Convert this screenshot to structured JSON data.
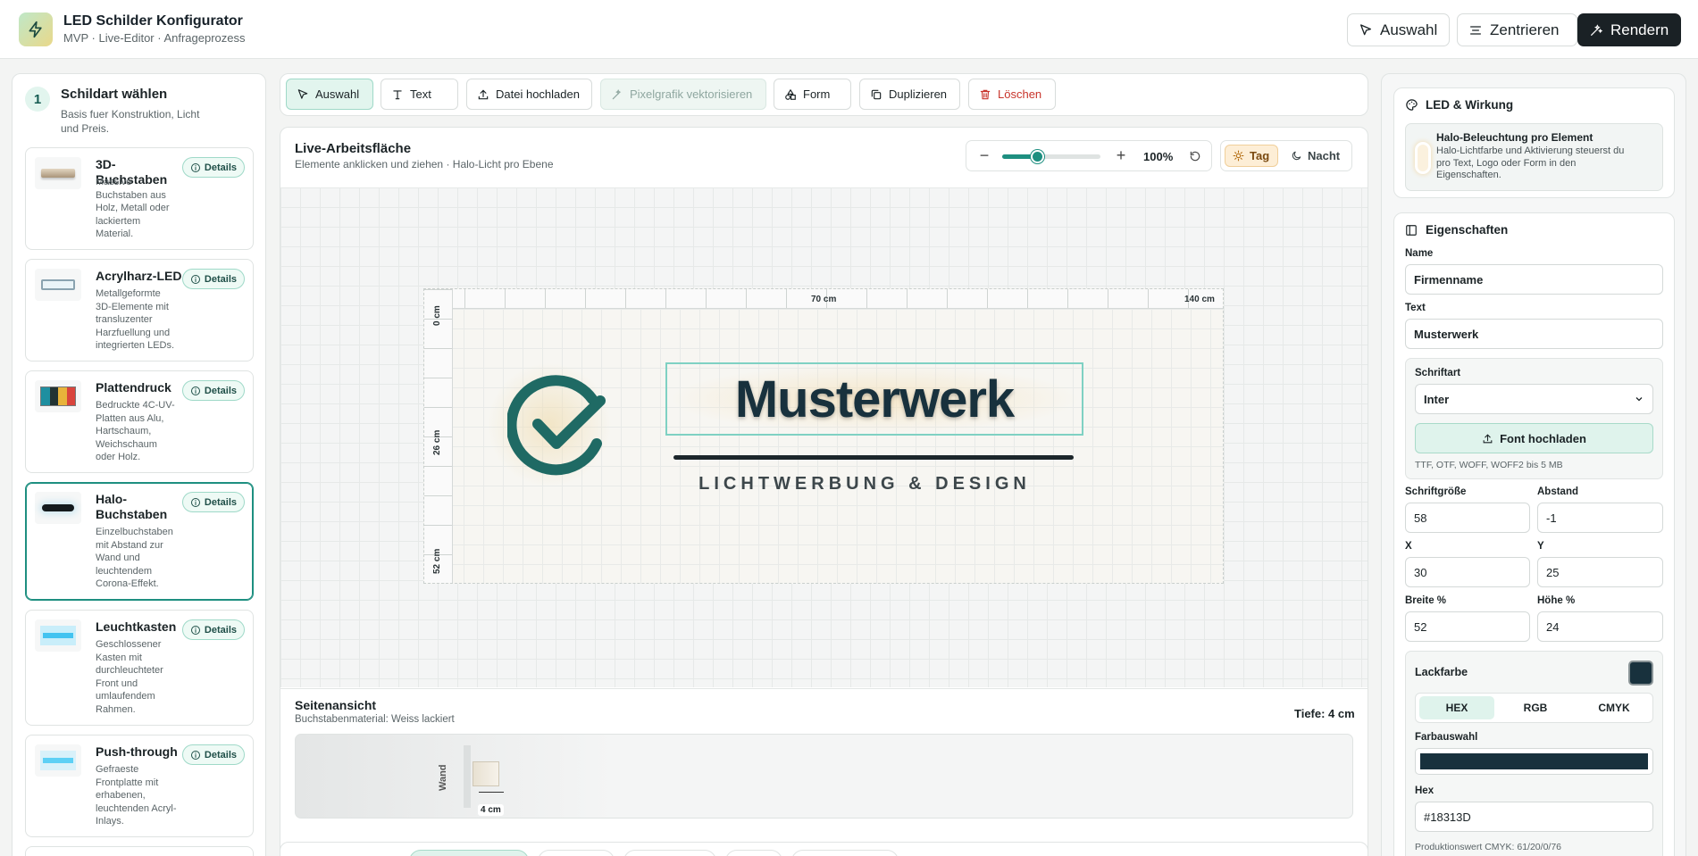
{
  "app": {
    "title": "LED Schilder Konfigurator",
    "subtitle": "MVP · Live-Editor · Anfrageprozess"
  },
  "header_actions": {
    "select": "Auswahl",
    "center": "Zentrieren",
    "render": "Rendern"
  },
  "left": {
    "step": "1",
    "title": "Schildart wählen",
    "subtitle": "Basis fuer Konstruktion, Licht und Preis.",
    "details_label": "Details",
    "cards": [
      {
        "title": "3D-Buchstaben",
        "desc": [
          "Massive",
          "Buchstaben aus",
          "Holz, Metall oder",
          "lackiertem",
          "Material."
        ]
      },
      {
        "title": "Acrylharz-LED",
        "desc": [
          "Metallgeformte",
          "3D-Elemente mit",
          "transluzenter",
          "Harzfuellung und",
          "integrierten LEDs."
        ]
      },
      {
        "title": "Plattendruck",
        "desc": [
          "Bedruckte 4C-UV-",
          "Platten aus Alu,",
          "Hartschaum,",
          "Weichschaum",
          "oder Holz."
        ]
      },
      {
        "title": "Halo-Buchstaben",
        "title_lines": [
          "Halo-",
          "Buchstaben"
        ],
        "desc": [
          "Einzelbuchstaben",
          "mit Abstand zur",
          "Wand und",
          "leuchtendem",
          "Corona-Effekt."
        ]
      },
      {
        "title": "Leuchtkasten",
        "desc": [
          "Geschlossener",
          "Kasten mit",
          "durchleuchteter",
          "Front und",
          "umlaufendem",
          "Rahmen."
        ]
      },
      {
        "title": "Push-through",
        "desc": [
          "Gefraeste",
          "Frontplatte mit",
          "erhabenen,",
          "leuchtenden Acryl-",
          "Inlays."
        ]
      }
    ]
  },
  "toolbar": {
    "select": "Auswahl",
    "text": "Text",
    "upload": "Datei hochladen",
    "vectorize": "Pixelgrafik vektorisieren",
    "shape": "Form",
    "duplicate": "Duplizieren",
    "delete": "Löschen"
  },
  "workspace": {
    "title": "Live-Arbeitsfläche",
    "subtitle": "Elemente anklicken und ziehen · Halo-Licht pro Ebene",
    "zoom": "100%",
    "zoom_fraction": 0.35,
    "day": "Tag",
    "night": "Nacht"
  },
  "sign": {
    "ruler_top": [
      "70 cm",
      "140 cm"
    ],
    "ruler_left": [
      "0 cm",
      "26 cm",
      "52 cm"
    ],
    "brand": "Musterwerk",
    "tagline": "LICHTWERBUNG & DESIGN"
  },
  "side_view": {
    "title": "Seitenansicht",
    "subtitle": "Buchstabenmaterial: Weiss lackiert",
    "depth": "Tiefe: 4 cm",
    "wall": "Wand",
    "dim": "4 cm"
  },
  "right": {
    "led_title": "LED & Wirkung",
    "halo_title": "Halo-Beleuchtung pro Element",
    "halo_desc": [
      "Halo-Lichtfarbe und Aktivierung steuerst du",
      "pro Text, Logo oder Form in den",
      "Eigenschaften."
    ],
    "props_title": "Eigenschaften",
    "name_label": "Name",
    "name_value": "Firmenname",
    "text_label": "Text",
    "text_value": "Musterwerk",
    "font_label": "Schriftart",
    "font_value": "Inter",
    "font_upload": "Font hochladen",
    "font_hint": "TTF, OTF, WOFF, WOFF2 bis 5 MB",
    "size_label": "Schriftgröße",
    "size_value": "58",
    "spacing_label": "Abstand",
    "spacing_value": "-1",
    "x_label": "X",
    "x_value": "30",
    "y_label": "Y",
    "y_value": "25",
    "width_label": "Breite %",
    "width_value": "52",
    "height_label": "Höhe %",
    "height_value": "24",
    "paint_label": "Lackfarbe",
    "color_tabs": [
      "HEX",
      "RGB",
      "CMYK"
    ],
    "picker_label": "Farbauswahl",
    "hex_label": "Hex",
    "hex_value": "#18313D",
    "cmyk_note": "Produktionswert CMYK: 61/20/0/76"
  },
  "colors": {
    "accent": "#1e8f80",
    "paint": "#18313D",
    "logo": "#1f6a64"
  }
}
